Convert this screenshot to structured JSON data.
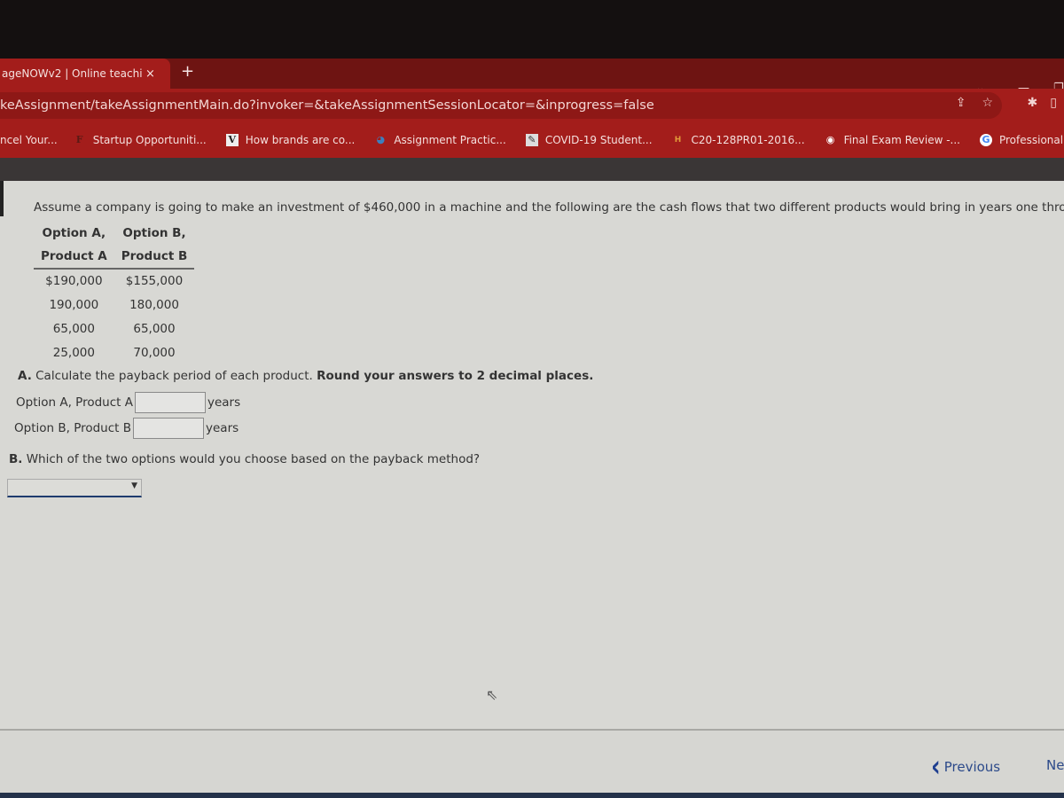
{
  "browser": {
    "tab_title": "ageNOWv2 | Online teachin",
    "tab_close": "×",
    "new_tab": "+",
    "url": "keAssignment/takeAssignmentMain.do?invoker=&takeAssignmentSessionLocator=&inprogress=false",
    "window_controls": {
      "dropdown": "⌄",
      "minimize": "—",
      "restore": "❐"
    },
    "omni_icons": {
      "share": "⇪",
      "star": "☆"
    },
    "ext_icons": {
      "extensions": "✱",
      "sidebar": "▯"
    },
    "bookmarks": [
      {
        "label": "ncel Your...",
        "icon": ""
      },
      {
        "label": "Startup Opportuniti...",
        "icon": "F"
      },
      {
        "label": "How brands are co...",
        "icon": "V"
      },
      {
        "label": "Assignment Practic...",
        "icon": "◕"
      },
      {
        "label": "COVID-19 Student...",
        "icon": "✎"
      },
      {
        "label": "C20-128PR01-2016...",
        "icon": "H"
      },
      {
        "label": "Final Exam Review -...",
        "icon": "◉"
      },
      {
        "label": "Professional Certific...",
        "icon": "G"
      }
    ]
  },
  "problem": {
    "intro": "Assume a company is going to make an investment of $460,000 in a machine and the following are the cash flows that two different products would bring in years one through four.",
    "table": {
      "headers_line1": [
        "Option A,",
        "Option B,"
      ],
      "headers_line2": [
        "Product A",
        "Product B"
      ],
      "rows": [
        [
          "$190,000",
          "$155,000"
        ],
        [
          "190,000",
          "180,000"
        ],
        [
          "65,000",
          "65,000"
        ],
        [
          "25,000",
          "70,000"
        ]
      ]
    },
    "part_a": {
      "prefix": "A.",
      "text": " Calculate the payback period of each product. ",
      "bold": "Round your answers to 2 decimal places.",
      "rows": [
        {
          "label": "Option A, Product A",
          "value": "",
          "unit": "years"
        },
        {
          "label": "Option B, Product B",
          "value": "",
          "unit": "years"
        }
      ]
    },
    "part_b": {
      "prefix": "B.",
      "text": " Which of the two options would you choose based on the payback method?",
      "select_value": "",
      "select_arrow": "▼"
    }
  },
  "footer": {
    "previous_label": "Previous",
    "previous_icon": "‹",
    "next_label": "Ne"
  },
  "cursor": "⇖"
}
